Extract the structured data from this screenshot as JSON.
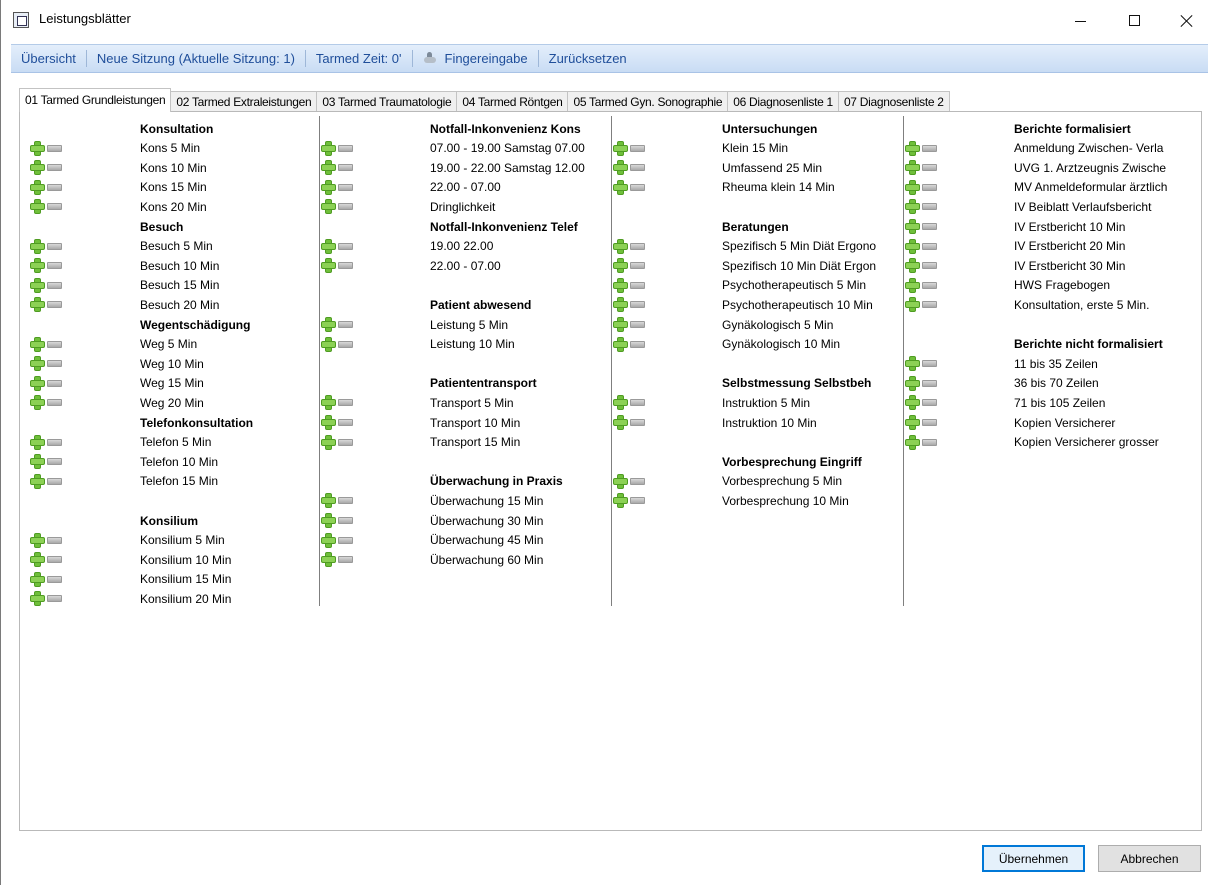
{
  "window": {
    "title": "Leistungsblätter"
  },
  "toolbar": {
    "overview": "Übersicht",
    "new_session": "Neue Sitzung (Aktuelle Sitzung: 1)",
    "tarmed_time": "Tarmed Zeit: 0'",
    "finger_input": "Fingereingabe",
    "reset": "Zurücksetzen"
  },
  "tabs": [
    {
      "label": "01 Tarmed Grundleistungen",
      "active": true
    },
    {
      "label": "02 Tarmed Extraleistungen"
    },
    {
      "label": "03 Tarmed Traumatologie"
    },
    {
      "label": "04 Tarmed Röntgen"
    },
    {
      "label": "05 Tarmed Gyn. Sonographie"
    },
    {
      "label": "06 Diagnosenliste 1"
    },
    {
      "label": "07 Diagnosenliste 2"
    }
  ],
  "columns": [
    {
      "rows": [
        {
          "type": "heading",
          "text": "Konsultation"
        },
        {
          "type": "item",
          "text": "Kons 5 Min"
        },
        {
          "type": "item",
          "text": "Kons 10 Min"
        },
        {
          "type": "item",
          "text": "Kons 15 Min"
        },
        {
          "type": "item",
          "text": "Kons 20 Min"
        },
        {
          "type": "heading",
          "text": "Besuch"
        },
        {
          "type": "item",
          "text": "Besuch  5 Min"
        },
        {
          "type": "item",
          "text": "Besuch 10 Min"
        },
        {
          "type": "item",
          "text": "Besuch 15 Min"
        },
        {
          "type": "item",
          "text": "Besuch 20 Min"
        },
        {
          "type": "heading",
          "text": "Wegentschädigung"
        },
        {
          "type": "item",
          "text": "Weg 5 Min"
        },
        {
          "type": "item",
          "text": "Weg 10 Min"
        },
        {
          "type": "item",
          "text": "Weg 15 Min"
        },
        {
          "type": "item",
          "text": "Weg 20 Min"
        },
        {
          "type": "heading",
          "text": "Telefonkonsultation"
        },
        {
          "type": "item",
          "text": "Telefon 5 Min"
        },
        {
          "type": "item",
          "text": "Telefon 10 Min"
        },
        {
          "type": "item",
          "text": "Telefon 15 Min"
        },
        {
          "type": "blank"
        },
        {
          "type": "heading",
          "text": "Konsilium"
        },
        {
          "type": "item",
          "text": "Konsilium 5 Min"
        },
        {
          "type": "item",
          "text": "Konsilium 10 Min"
        },
        {
          "type": "item",
          "text": "Konsilium 15 Min"
        },
        {
          "type": "item",
          "text": "Konsilium 20 Min"
        }
      ]
    },
    {
      "rows": [
        {
          "type": "heading",
          "text": "Notfall-Inkonvenienz Kons"
        },
        {
          "type": "item",
          "text": "07.00 - 19.00 Samstag 07.00"
        },
        {
          "type": "item",
          "text": "19.00 - 22.00 Samstag 12.00"
        },
        {
          "type": "item",
          "text": "22.00 - 07.00"
        },
        {
          "type": "item",
          "text": "Dringlichkeit"
        },
        {
          "type": "heading",
          "text": "Notfall-Inkonvenienz Telef"
        },
        {
          "type": "item",
          "text": "19.00 22.00"
        },
        {
          "type": "item",
          "text": "22.00 - 07.00"
        },
        {
          "type": "blank"
        },
        {
          "type": "heading",
          "text": "Patient abwesend"
        },
        {
          "type": "item",
          "text": "Leistung 5 Min"
        },
        {
          "type": "item",
          "text": "Leistung 10 Min"
        },
        {
          "type": "blank"
        },
        {
          "type": "heading",
          "text": "Patiententransport"
        },
        {
          "type": "item",
          "text": "Transport 5 Min"
        },
        {
          "type": "item",
          "text": "Transport 10 Min"
        },
        {
          "type": "item",
          "text": "Transport 15 Min"
        },
        {
          "type": "blank"
        },
        {
          "type": "heading",
          "text": "Überwachung in Praxis"
        },
        {
          "type": "item",
          "text": "Überwachung 15 Min"
        },
        {
          "type": "item",
          "text": "Überwachung 30 Min"
        },
        {
          "type": "item",
          "text": "Überwachung 45 Min"
        },
        {
          "type": "item",
          "text": "Überwachung 60 Min"
        }
      ]
    },
    {
      "rows": [
        {
          "type": "heading",
          "text": "Untersuchungen"
        },
        {
          "type": "item",
          "text": "Klein 15 Min"
        },
        {
          "type": "item",
          "text": "Umfassend 25 Min"
        },
        {
          "type": "item",
          "text": "Rheuma klein 14 Min"
        },
        {
          "type": "blank"
        },
        {
          "type": "heading",
          "text": "Beratungen"
        },
        {
          "type": "item",
          "text": "Spezifisch 5 Min Diät Ergono"
        },
        {
          "type": "item",
          "text": "Spezifisch 10 Min Diät Ergon"
        },
        {
          "type": "item",
          "text": "Psychotherapeutisch 5 Min"
        },
        {
          "type": "item",
          "text": "Psychotherapeutisch 10 Min"
        },
        {
          "type": "item",
          "text": "Gynäkologisch 5 Min"
        },
        {
          "type": "item",
          "text": "Gynäkologisch 10 Min"
        },
        {
          "type": "blank"
        },
        {
          "type": "heading",
          "text": "Selbstmessung Selbstbeh"
        },
        {
          "type": "item",
          "text": "Instruktion 5 Min"
        },
        {
          "type": "item",
          "text": "Instruktion 10 Min"
        },
        {
          "type": "blank"
        },
        {
          "type": "heading",
          "text": "Vorbesprechung Eingriff"
        },
        {
          "type": "item",
          "text": "Vorbesprechung 5 Min"
        },
        {
          "type": "item",
          "text": "Vorbesprechung 10 Min"
        }
      ]
    },
    {
      "rows": [
        {
          "type": "heading",
          "text": "Berichte formalisiert"
        },
        {
          "type": "item",
          "text": "Anmeldung Zwischen- Verla"
        },
        {
          "type": "item",
          "text": "UVG 1. Arztzeugnis Zwische"
        },
        {
          "type": "item",
          "text": "MV Anmeldeformular ärztlich"
        },
        {
          "type": "item",
          "text": "IV Beiblatt Verlaufsbericht"
        },
        {
          "type": "item",
          "text": "IV Erstbericht 10 Min"
        },
        {
          "type": "item",
          "text": "IV Erstbericht 20 Min"
        },
        {
          "type": "item",
          "text": "IV Erstbericht 30 Min"
        },
        {
          "type": "item",
          "text": "HWS Fragebogen"
        },
        {
          "type": "item",
          "text": "Konsultation, erste 5 Min."
        },
        {
          "type": "blank"
        },
        {
          "type": "heading",
          "text": "Berichte nicht formalisiert"
        },
        {
          "type": "item",
          "text": "11 bis 35 Zeilen"
        },
        {
          "type": "item",
          "text": "36 bis 70 Zeilen"
        },
        {
          "type": "item",
          "text": "71 bis 105 Zeilen"
        },
        {
          "type": "item",
          "text": "Kopien Versicherer"
        },
        {
          "type": "item",
          "text": "Kopien Versicherer grosser"
        }
      ]
    }
  ],
  "buttons": {
    "ok": "Übernehmen",
    "cancel": "Abbrechen"
  }
}
